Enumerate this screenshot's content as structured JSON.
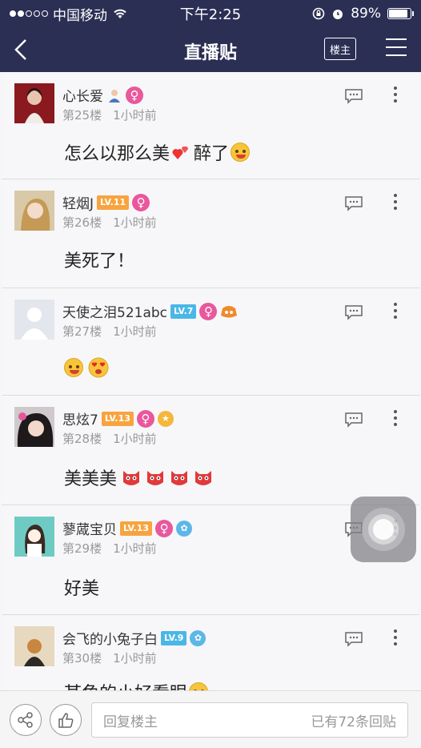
{
  "status_bar": {
    "carrier": "中国移动",
    "time": "下午2:25",
    "battery": "89%",
    "battery_fill": 0.89,
    "signal_bars_filled": 2,
    "signal_bars_total": 5
  },
  "nav": {
    "title": "直播贴",
    "louzhu_label": "楼主"
  },
  "posts": [
    {
      "username": "心长爱",
      "level": "",
      "floor": "第25楼",
      "time": "1小时前",
      "content_a": "怎么以那么美",
      "content_b": "醉了"
    },
    {
      "username": "轻烟J",
      "level": "LV.11",
      "floor": "第26楼",
      "time": "1小时前",
      "content_a": "美死了！"
    },
    {
      "username": "天使之泪521abc",
      "level": "LV.7",
      "floor": "第27楼",
      "time": "1小时前"
    },
    {
      "username": "思炫7",
      "level": "LV.13",
      "floor": "第28楼",
      "time": "1小时前",
      "content_a": "美美美"
    },
    {
      "username": "蓼蒧宝贝",
      "level": "LV.13",
      "floor": "第29楼",
      "time": "1小时前",
      "content_a": "好美"
    },
    {
      "username": "会飞的小兔子白",
      "level": "LV.9",
      "floor": "第30楼",
      "time": "1小时前",
      "content_a": "某角的小好看眼"
    }
  ],
  "colors": {
    "nav_bg": "#2b2f54",
    "female_badge": "#e9579c",
    "level_orange": "#f7a440",
    "level_blue": "#4ab7e6"
  },
  "bottom": {
    "reply_placeholder": "回复楼主",
    "reply_count": "已有72条回贴",
    "share_icon": "share-icon",
    "like_icon": "thumbs-up-icon"
  }
}
